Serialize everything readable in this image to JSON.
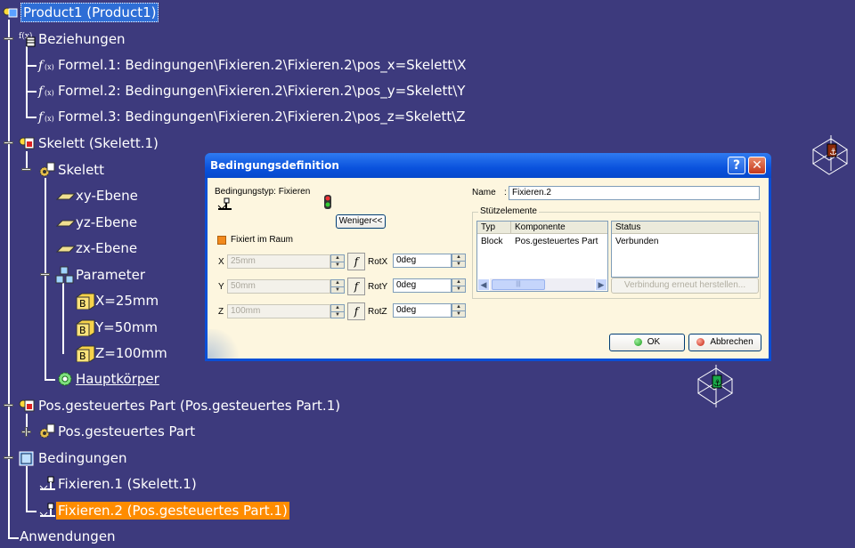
{
  "tree": {
    "product": "Product1 (Product1)",
    "beziehungen": "Beziehungen",
    "formeln": [
      "Formel.1: Bedingungen\\Fixieren.2\\Fixieren.2\\pos_x=Skelett\\X",
      "Formel.2: Bedingungen\\Fixieren.2\\Fixieren.2\\pos_y=Skelett\\Y",
      "Formel.3: Bedingungen\\Fixieren.2\\Fixieren.2\\pos_z=Skelett\\Z"
    ],
    "skelett_instance": "Skelett (Skelett.1)",
    "skelett_part": "Skelett",
    "planes": [
      "xy-Ebene",
      "yz-Ebene",
      "zx-Ebene"
    ],
    "parameter": "Parameter",
    "params": [
      "X=25mm",
      "Y=50mm",
      "Z=100mm"
    ],
    "hauptkoerper": "Hauptkörper",
    "pos_instance": "Pos.gesteuertes Part (Pos.gesteuertes Part.1)",
    "pos_part": "Pos.gesteuertes Part",
    "bedingungen": "Bedingungen",
    "fixieren1": "Fixieren.1 (Skelett.1)",
    "fixieren2": "Fixieren.2 (Pos.gesteuertes Part.1)",
    "anwendungen": "Anwendungen"
  },
  "dialog": {
    "title": "Bedingungsdefinition",
    "help_button": "?",
    "close_button": "✕",
    "type_label": "Bedingungstyp: Fixieren",
    "less_button": "Weniger<<",
    "fixed_in_space": "Fixiert im Raum",
    "x_label": "X",
    "x_value": "25mm",
    "y_label": "Y",
    "y_value": "50mm",
    "z_label": "Z",
    "z_value": "100mm",
    "rotx_label": "RotX",
    "rotx_value": "0deg",
    "roty_label": "RotY",
    "roty_value": "0deg",
    "rotz_label": "RotZ",
    "rotz_value": "0deg",
    "name_label": "Name",
    "name_value": "Fixieren.2",
    "support_group": "Stützelemente",
    "col_typ": "Typ",
    "col_komponente": "Komponente",
    "col_status": "Status",
    "row_typ": "Block",
    "row_komponente": "Pos.gesteuertes Part",
    "row_status": "Verbunden",
    "reconnect_button": "Verbindung erneut herstellen...",
    "ok_button": "OK",
    "cancel_button": "Abbrechen"
  },
  "colors": {
    "background": "#3d3a7d",
    "selection_blue": "#2e6ed6",
    "selection_orange": "#ff8c00",
    "dialog_body": "#fdf6df",
    "title_bar": "#0a52dd"
  }
}
